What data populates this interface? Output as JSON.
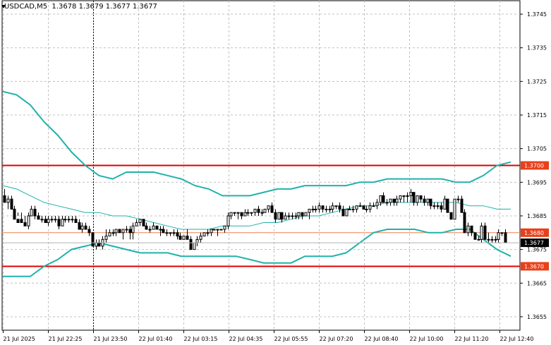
{
  "header": {
    "symbol": "USDCAD,M5",
    "ohlc": "1.3678 1.3679 1.3677 1.3677"
  },
  "colors": {
    "background": "#ffffff",
    "grid": "#c0c0c0",
    "candle": "#000000",
    "band": "#20b2aa",
    "level_line": "#e00000",
    "level_label_bg": "#e8401a",
    "mid_line": "#f08050",
    "price_label_bg": "#000000",
    "price_label_text": "#ffffff"
  },
  "chart_data": {
    "type": "candlestick",
    "symbol": "USDCAD",
    "timeframe": "M5",
    "y_axis": {
      "range": [
        1.3651,
        1.3749
      ],
      "ticks": [
        "1.3745",
        "1.3735",
        "1.3725",
        "1.3715",
        "1.3705",
        "1.3695",
        "1.3685",
        "1.3675",
        "1.3665",
        "1.3655"
      ],
      "tick_values": [
        1.3745,
        1.3735,
        1.3725,
        1.3715,
        1.3705,
        1.3695,
        1.3685,
        1.3675,
        1.3665,
        1.3655
      ]
    },
    "x_axis": {
      "ticks": [
        "21 Jul 2025",
        "21 Jul 22:25",
        "21 Jul 23:50",
        "22 Jul 01:40",
        "22 Jul 03:15",
        "22 Jul 04:35",
        "22 Jul 05:55",
        "22 Jul 07:20",
        "22 Jul 08:40",
        "22 Jul 10:00",
        "22 Jul 11:20",
        "22 Jul 12:40"
      ]
    },
    "horizontal_levels": [
      {
        "value": 1.37,
        "label": "1.3700"
      },
      {
        "value": 1.368,
        "label": "1.3680"
      },
      {
        "value": 1.367,
        "label": "1.3670"
      }
    ],
    "current_price": {
      "value": 1.3677,
      "label": "1.3677"
    },
    "grid": true,
    "candles": [
      [
        1.3691,
        1.3693,
        1.369,
        1.3689
      ],
      [
        1.3689,
        1.3691,
        1.3687,
        1.369
      ],
      [
        1.369,
        1.3691,
        1.3687,
        1.3687
      ],
      [
        1.3687,
        1.3688,
        1.3685,
        1.3684
      ],
      [
        1.3684,
        1.3686,
        1.3685,
        1.3683
      ],
      [
        1.3684,
        1.3686,
        1.3683,
        1.3683
      ],
      [
        1.3683,
        1.3685,
        1.3682,
        1.3682
      ],
      [
        1.3682,
        1.3686,
        1.3681,
        1.3685
      ],
      [
        1.3685,
        1.3688,
        1.3685,
        1.3687
      ],
      [
        1.3687,
        1.3688,
        1.3684,
        1.3685
      ],
      [
        1.3685,
        1.3686,
        1.3684,
        1.3684
      ],
      [
        1.3684,
        1.3685,
        1.3683,
        1.3684
      ],
      [
        1.3684,
        1.3685,
        1.3683,
        1.3683
      ],
      [
        1.3683,
        1.3685,
        1.3682,
        1.3684
      ],
      [
        1.3684,
        1.3685,
        1.3683,
        1.3684
      ],
      [
        1.3684,
        1.3685,
        1.3683,
        1.3684
      ],
      [
        1.3684,
        1.3685,
        1.3681,
        1.3682
      ],
      [
        1.3682,
        1.3685,
        1.3682,
        1.3684
      ],
      [
        1.3684,
        1.3685,
        1.3683,
        1.3684
      ],
      [
        1.3684,
        1.3685,
        1.3683,
        1.3684
      ],
      [
        1.3684,
        1.3685,
        1.3683,
        1.3684
      ],
      [
        1.3684,
        1.3685,
        1.3683,
        1.3683
      ],
      [
        1.3683,
        1.3684,
        1.3681,
        1.3681
      ],
      [
        1.3681,
        1.3683,
        1.368,
        1.3682
      ],
      [
        1.3682,
        1.3683,
        1.3681,
        1.3681
      ],
      [
        1.3681,
        1.3682,
        1.3679,
        1.368
      ],
      [
        1.368,
        1.368,
        1.3676,
        1.3676
      ],
      [
        1.3676,
        1.3678,
        1.3675,
        1.3677
      ],
      [
        1.3677,
        1.3678,
        1.3676,
        1.3676
      ],
      [
        1.3676,
        1.3679,
        1.3675,
        1.3678
      ],
      [
        1.3678,
        1.3681,
        1.3677,
        1.3679
      ],
      [
        1.3679,
        1.3681,
        1.3679,
        1.368
      ],
      [
        1.368,
        1.3681,
        1.3679,
        1.368
      ],
      [
        1.368,
        1.3681,
        1.3679,
        1.3681
      ],
      [
        1.3681,
        1.3681,
        1.368,
        1.368
      ],
      [
        1.368,
        1.3681,
        1.3678,
        1.3681
      ],
      [
        1.3681,
        1.3682,
        1.368,
        1.3681
      ],
      [
        1.3681,
        1.3682,
        1.3678,
        1.368
      ],
      [
        1.368,
        1.3683,
        1.3678,
        1.3682
      ],
      [
        1.3682,
        1.3684,
        1.3682,
        1.3683
      ],
      [
        1.3683,
        1.3684,
        1.3682,
        1.3684
      ],
      [
        1.3684,
        1.3684,
        1.3682,
        1.3682
      ],
      [
        1.3682,
        1.3683,
        1.3681,
        1.3681
      ],
      [
        1.3681,
        1.3682,
        1.368,
        1.3681
      ],
      [
        1.3681,
        1.3683,
        1.3681,
        1.3682
      ],
      [
        1.3682,
        1.3682,
        1.3681,
        1.3681
      ],
      [
        1.3681,
        1.3682,
        1.3679,
        1.3681
      ],
      [
        1.3681,
        1.3682,
        1.368,
        1.368
      ],
      [
        1.368,
        1.3681,
        1.3679,
        1.368
      ],
      [
        1.368,
        1.368,
        1.3679,
        1.368
      ],
      [
        1.368,
        1.3681,
        1.3679,
        1.368
      ],
      [
        1.368,
        1.3681,
        1.3678,
        1.3679
      ],
      [
        1.3679,
        1.368,
        1.3678,
        1.3678
      ],
      [
        1.3678,
        1.3679,
        1.3678,
        1.3679
      ],
      [
        1.3679,
        1.3681,
        1.3678,
        1.3678
      ],
      [
        1.3678,
        1.3679,
        1.3675,
        1.3675
      ],
      [
        1.3675,
        1.3677,
        1.3675,
        1.3677
      ],
      [
        1.3677,
        1.3679,
        1.3676,
        1.3678
      ],
      [
        1.3678,
        1.368,
        1.3677,
        1.3679
      ],
      [
        1.3679,
        1.368,
        1.3679,
        1.368
      ],
      [
        1.368,
        1.3681,
        1.3679,
        1.368
      ],
      [
        1.368,
        1.3681,
        1.3679,
        1.3681
      ],
      [
        1.3681,
        1.3681,
        1.3681,
        1.3681
      ],
      [
        1.3681,
        1.3681,
        1.3679,
        1.3681
      ],
      [
        1.3681,
        1.3681,
        1.3681,
        1.3681
      ],
      [
        1.3681,
        1.3682,
        1.368,
        1.3682
      ],
      [
        1.3682,
        1.3686,
        1.3681,
        1.3685
      ],
      [
        1.3685,
        1.3686,
        1.3684,
        1.3686
      ],
      [
        1.3686,
        1.3686,
        1.3685,
        1.3686
      ],
      [
        1.3686,
        1.3686,
        1.3684,
        1.3686
      ],
      [
        1.3686,
        1.3686,
        1.3684,
        1.3685
      ],
      [
        1.3685,
        1.3687,
        1.3685,
        1.3686
      ],
      [
        1.3686,
        1.3687,
        1.3685,
        1.3686
      ],
      [
        1.3686,
        1.3686,
        1.3685,
        1.3686
      ],
      [
        1.3686,
        1.3687,
        1.3685,
        1.3687
      ],
      [
        1.3687,
        1.3688,
        1.3685,
        1.3686
      ],
      [
        1.3686,
        1.3687,
        1.3685,
        1.3686
      ],
      [
        1.3686,
        1.3687,
        1.3686,
        1.3687
      ],
      [
        1.3687,
        1.3688,
        1.3686,
        1.3688
      ],
      [
        1.3688,
        1.3689,
        1.3686,
        1.3686
      ],
      [
        1.3686,
        1.3687,
        1.3683,
        1.3684
      ],
      [
        1.3684,
        1.3686,
        1.3684,
        1.3686
      ],
      [
        1.3686,
        1.3686,
        1.3683,
        1.3684
      ],
      [
        1.3684,
        1.3686,
        1.3684,
        1.3685
      ],
      [
        1.3685,
        1.3686,
        1.3684,
        1.3685
      ],
      [
        1.3685,
        1.3686,
        1.3684,
        1.3685
      ],
      [
        1.3685,
        1.3686,
        1.3684,
        1.3685
      ],
      [
        1.3685,
        1.3686,
        1.3684,
        1.3686
      ],
      [
        1.3686,
        1.3686,
        1.3684,
        1.3685
      ],
      [
        1.3685,
        1.3686,
        1.3685,
        1.3686
      ],
      [
        1.3686,
        1.3687,
        1.3684,
        1.3687
      ],
      [
        1.3687,
        1.3688,
        1.3686,
        1.3687
      ],
      [
        1.3687,
        1.3688,
        1.3686,
        1.3687
      ],
      [
        1.3687,
        1.3689,
        1.3686,
        1.3688
      ],
      [
        1.3688,
        1.3688,
        1.3686,
        1.3687
      ],
      [
        1.3687,
        1.3688,
        1.3686,
        1.3687
      ],
      [
        1.3687,
        1.3688,
        1.3686,
        1.3687
      ],
      [
        1.3687,
        1.3689,
        1.3686,
        1.3688
      ],
      [
        1.3688,
        1.3688,
        1.3687,
        1.3688
      ],
      [
        1.3688,
        1.3689,
        1.3686,
        1.3687
      ],
      [
        1.3687,
        1.3688,
        1.3685,
        1.3685
      ],
      [
        1.3685,
        1.3687,
        1.3685,
        1.3687
      ],
      [
        1.3687,
        1.3688,
        1.3687,
        1.3687
      ],
      [
        1.3687,
        1.3688,
        1.3686,
        1.3687
      ],
      [
        1.3687,
        1.3688,
        1.3686,
        1.3688
      ],
      [
        1.3688,
        1.3689,
        1.3688,
        1.3688
      ],
      [
        1.3688,
        1.3688,
        1.3687,
        1.3687
      ],
      [
        1.3687,
        1.3688,
        1.3686,
        1.3687
      ],
      [
        1.3687,
        1.3689,
        1.3686,
        1.3688
      ],
      [
        1.3688,
        1.3689,
        1.3688,
        1.3688
      ],
      [
        1.3688,
        1.369,
        1.3687,
        1.3689
      ],
      [
        1.3689,
        1.3691,
        1.3688,
        1.3691
      ],
      [
        1.3691,
        1.3692,
        1.3689,
        1.3689
      ],
      [
        1.3689,
        1.369,
        1.3688,
        1.3689
      ],
      [
        1.3689,
        1.369,
        1.3688,
        1.369
      ],
      [
        1.369,
        1.369,
        1.3688,
        1.3689
      ],
      [
        1.3689,
        1.3691,
        1.3688,
        1.369
      ],
      [
        1.369,
        1.3691,
        1.3689,
        1.3691
      ],
      [
        1.3691,
        1.3691,
        1.3689,
        1.3691
      ],
      [
        1.3691,
        1.3692,
        1.3689,
        1.3691
      ],
      [
        1.3691,
        1.3693,
        1.3689,
        1.3692
      ],
      [
        1.3692,
        1.3692,
        1.3688,
        1.3689
      ],
      [
        1.3689,
        1.3691,
        1.3688,
        1.3691
      ],
      [
        1.3691,
        1.3691,
        1.3689,
        1.369
      ],
      [
        1.369,
        1.3691,
        1.3688,
        1.3689
      ],
      [
        1.3689,
        1.369,
        1.3688,
        1.369
      ],
      [
        1.369,
        1.369,
        1.3687,
        1.3688
      ],
      [
        1.3688,
        1.3689,
        1.3687,
        1.3688
      ],
      [
        1.3688,
        1.3689,
        1.3687,
        1.3688
      ],
      [
        1.3688,
        1.3689,
        1.3686,
        1.3687
      ],
      [
        1.3687,
        1.3691,
        1.3687,
        1.369
      ],
      [
        1.369,
        1.369,
        1.3686,
        1.3686
      ],
      [
        1.3686,
        1.3686,
        1.3684,
        1.3684
      ],
      [
        1.3684,
        1.369,
        1.3684,
        1.369
      ],
      [
        1.369,
        1.3691,
        1.3689,
        1.369
      ],
      [
        1.369,
        1.3691,
        1.3686,
        1.3686
      ],
      [
        1.3686,
        1.3687,
        1.368,
        1.368
      ],
      [
        1.368,
        1.3683,
        1.3679,
        1.3682
      ],
      [
        1.3682,
        1.3682,
        1.3679,
        1.368
      ],
      [
        1.368,
        1.368,
        1.3678,
        1.3678
      ],
      [
        1.3678,
        1.3679,
        1.3678,
        1.3678
      ],
      [
        1.3678,
        1.3683,
        1.3677,
        1.3682
      ],
      [
        1.3682,
        1.3683,
        1.3678,
        1.3678
      ],
      [
        1.3678,
        1.368,
        1.3677,
        1.3678
      ],
      [
        1.3678,
        1.3679,
        1.3677,
        1.3678
      ],
      [
        1.3678,
        1.3679,
        1.3677,
        1.3678
      ],
      [
        1.3678,
        1.3681,
        1.3677,
        1.368
      ],
      [
        1.368,
        1.368,
        1.3679,
        1.368
      ],
      [
        1.368,
        1.3681,
        1.3677,
        1.3677
      ]
    ],
    "band_upper": [
      1.3722,
      1.3721,
      1.3718,
      1.3713,
      1.3709,
      1.3704,
      1.37,
      1.3697,
      1.3696,
      1.3698,
      1.3698,
      1.3698,
      1.3697,
      1.3696,
      1.3694,
      1.3693,
      1.3691,
      1.3691,
      1.3691,
      1.3692,
      1.3693,
      1.3693,
      1.3694,
      1.3694,
      1.3694,
      1.3694,
      1.3695,
      1.3695,
      1.3696,
      1.3696,
      1.3696,
      1.3696,
      1.3696,
      1.3695,
      1.3695,
      1.3697,
      1.37,
      1.3701
    ],
    "band_middle": [
      1.3694,
      1.3693,
      1.3691,
      1.3689,
      1.3688,
      1.3687,
      1.3686,
      1.3686,
      1.3685,
      1.3685,
      1.3684,
      1.3683,
      1.3682,
      1.3681,
      1.3681,
      1.3681,
      1.3682,
      1.3682,
      1.3682,
      1.3683,
      1.3683,
      1.3684,
      1.3685,
      1.3685,
      1.3686,
      1.3687,
      1.3688,
      1.3688,
      1.3689,
      1.3689,
      1.3689,
      1.3689,
      1.3689,
      1.3689,
      1.3688,
      1.3688,
      1.3687,
      1.3687
    ],
    "band_lower": [
      1.3667,
      1.3667,
      1.3667,
      1.367,
      1.3672,
      1.3675,
      1.3676,
      1.3677,
      1.3676,
      1.3675,
      1.3674,
      1.3674,
      1.3674,
      1.3673,
      1.3673,
      1.3673,
      1.3673,
      1.3673,
      1.3672,
      1.3671,
      1.3671,
      1.3671,
      1.3673,
      1.3673,
      1.3673,
      1.3674,
      1.3677,
      1.368,
      1.3681,
      1.3681,
      1.3681,
      1.368,
      1.368,
      1.3681,
      1.3681,
      1.3678,
      1.3675,
      1.3673
    ]
  }
}
